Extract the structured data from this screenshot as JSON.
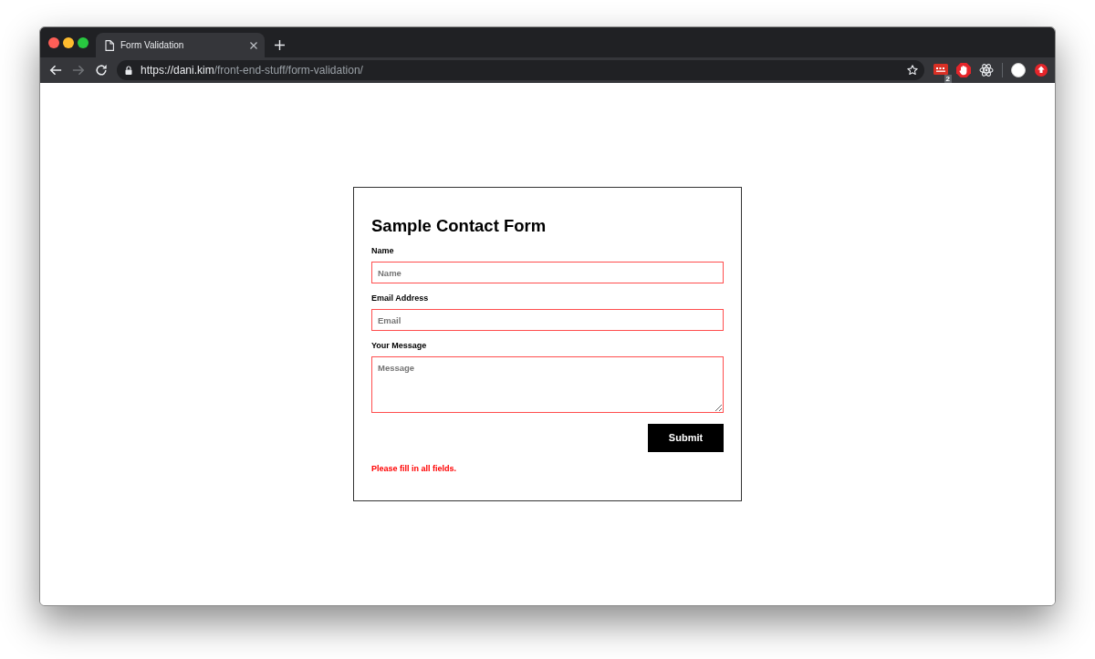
{
  "browser": {
    "tabs": [
      {
        "title": "Form Validation",
        "selected": true
      }
    ],
    "navigation": [
      {
        "kind": "back",
        "disabled": false
      },
      {
        "kind": "forward",
        "disabled": true
      },
      {
        "kind": "reload",
        "disabled": false
      }
    ],
    "address": {
      "origin": "https://dani.kim",
      "path": "/front-end-stuff/form-validation/"
    },
    "extensions": [
      {
        "kind": "dots",
        "badge": "2"
      },
      {
        "kind": "hand"
      },
      {
        "kind": "atom"
      },
      {
        "kind": "avatar"
      },
      {
        "kind": "upload"
      }
    ]
  },
  "form": {
    "title": "Sample Contact Form",
    "fields": [
      {
        "label": "Name",
        "placeholder": "Name",
        "kind": "input",
        "invalid": true
      },
      {
        "label": "Email Address",
        "placeholder": "Email",
        "kind": "input",
        "invalid": true
      },
      {
        "label": "Your Message",
        "placeholder": "Message",
        "kind": "textarea",
        "invalid": true
      }
    ],
    "submit": "Submit",
    "error": "Please fill in all fields."
  }
}
